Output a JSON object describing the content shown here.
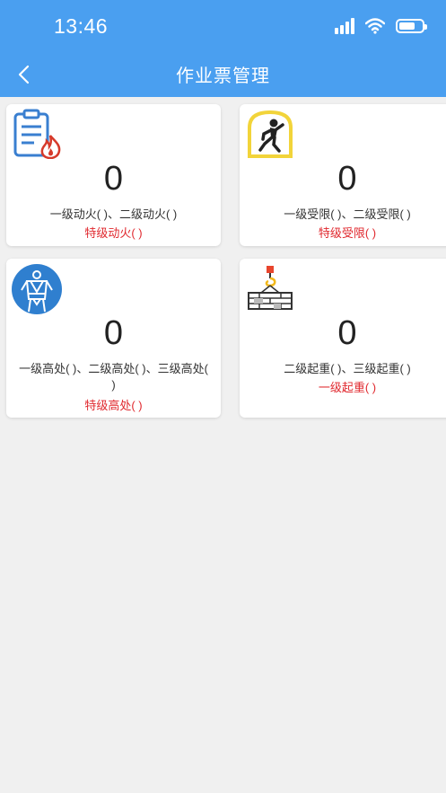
{
  "status_bar": {
    "time": "13:46"
  },
  "nav": {
    "title": "作业票管理"
  },
  "cards": [
    {
      "count": "0",
      "line1": "一级动火( )、二级动火( )",
      "line2": "特级动火( )",
      "icon": "hot-work-clipboard-icon"
    },
    {
      "count": "0",
      "line1": "一级受限( )、二级受限( )",
      "line2": "特级受限( )",
      "icon": "confined-space-icon"
    },
    {
      "count": "0",
      "line1": "一级高处( )、二级高处( )、三级高处(",
      "line1b": ")",
      "line2": "特级高处( )",
      "icon": "safety-harness-icon"
    },
    {
      "count": "0",
      "line1": "二级起重( )、三级起重( )",
      "line2": "一级起重( )",
      "icon": "crane-hook-icon"
    }
  ],
  "colors": {
    "header": "#4a9ff0",
    "accent_red": "#e0282e",
    "background": "#f0f0f0"
  }
}
